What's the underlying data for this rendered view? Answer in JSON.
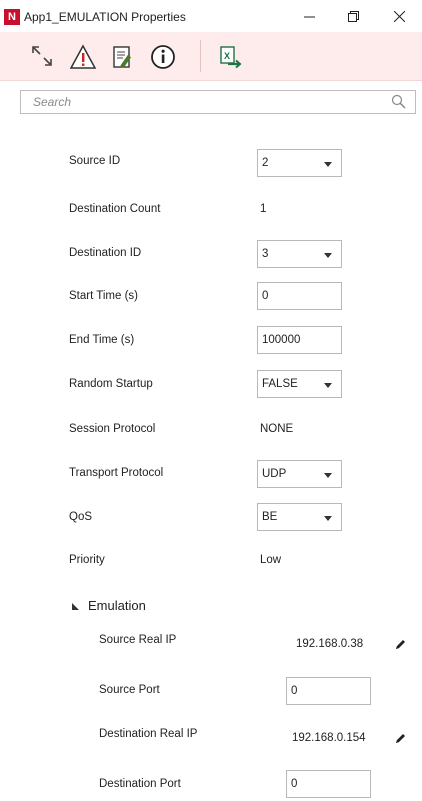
{
  "window": {
    "title": "App1_EMULATION Properties",
    "logo_letter": "N",
    "logo_color": "#c8102e"
  },
  "toolbar": {
    "accent": "#fdeceb",
    "buttons": [
      {
        "icon": "expand-arrows-icon"
      },
      {
        "icon": "warning-icon"
      },
      {
        "icon": "edit-document-icon"
      },
      {
        "icon": "info-icon"
      },
      {
        "icon": "excel-export-icon"
      }
    ]
  },
  "search": {
    "placeholder": "Search"
  },
  "properties": [
    {
      "label": "Source ID",
      "value": "2",
      "type": "select"
    },
    {
      "label": "Destination Count",
      "value": "1",
      "type": "text"
    },
    {
      "label": "Destination ID",
      "value": "3",
      "type": "select"
    },
    {
      "label": "Start Time (s)",
      "value": "0",
      "type": "input"
    },
    {
      "label": "End Time (s)",
      "value": "100000",
      "type": "input"
    },
    {
      "label": "Random Startup",
      "value": "FALSE",
      "type": "select"
    },
    {
      "label": "Session Protocol",
      "value": "NONE",
      "type": "text"
    },
    {
      "label": "Transport Protocol",
      "value": "UDP",
      "type": "select"
    },
    {
      "label": "QoS",
      "value": "BE",
      "type": "select"
    },
    {
      "label": "Priority",
      "value": "Low",
      "type": "text"
    }
  ],
  "emulation": {
    "title": "Emulation",
    "items": [
      {
        "label": "Source Real IP",
        "value": "192.168.0.38",
        "type": "editable-text"
      },
      {
        "label": "Source Port",
        "value": "0",
        "type": "input"
      },
      {
        "label": "Destination Real IP",
        "value": "192.168.0.154",
        "type": "editable-text"
      },
      {
        "label": "Destination Port",
        "value": "0",
        "type": "input"
      }
    ]
  }
}
